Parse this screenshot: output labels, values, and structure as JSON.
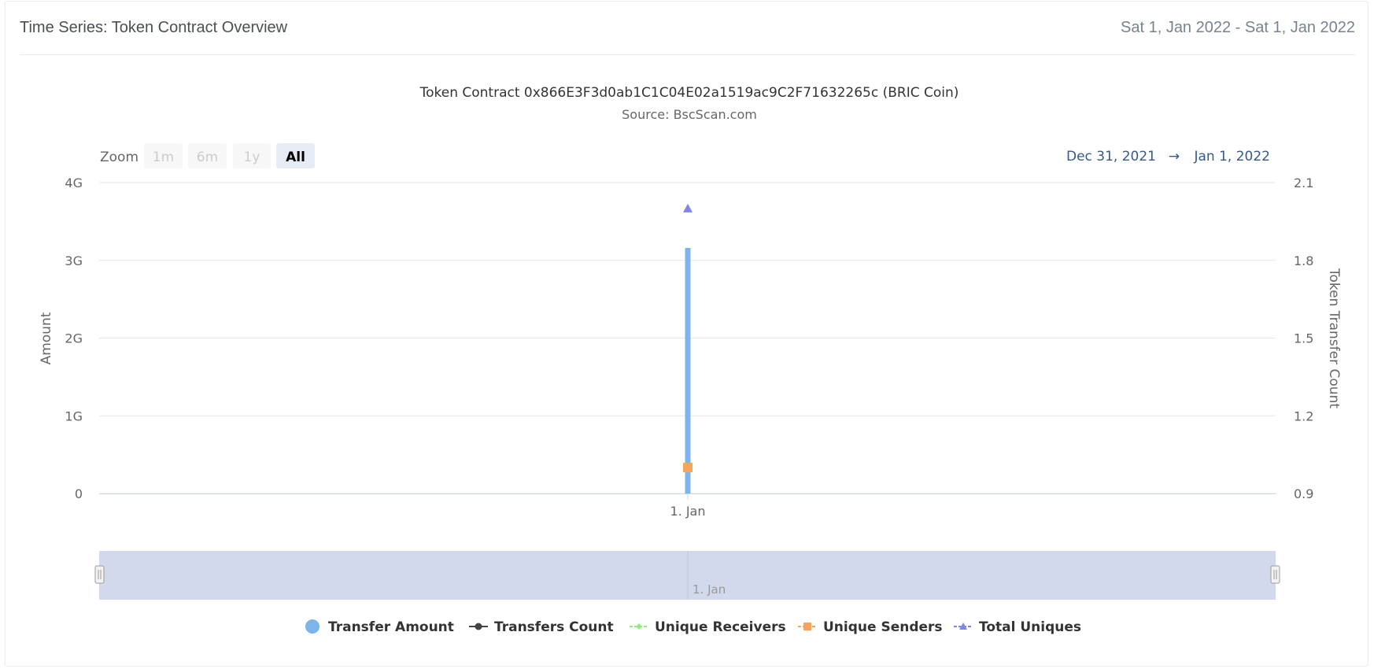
{
  "card": {
    "title": "Time Series: Token Contract Overview",
    "date_range": "Sat 1, Jan 2022 - Sat 1, Jan 2022"
  },
  "range_selector": {
    "zoom_label": "Zoom",
    "buttons": [
      "1m",
      "6m",
      "1y",
      "All"
    ],
    "active": "All",
    "from": "Dec 31, 2021",
    "arrow": "→",
    "to": "Jan 1, 2022"
  },
  "navigator": {
    "label": "1. Jan"
  },
  "colors": {
    "transfer_amount": "#7cb5ec",
    "transfers_count": "#434348",
    "unique_receivers": "#90ed7d",
    "unique_senders": "#f7a35c",
    "total_uniques": "#8085e9",
    "navigator_fill": "#d3d9ec",
    "grid": "#e6e6e6"
  },
  "chart_data": {
    "type": "bar",
    "title": "Token Contract 0x866E3F3d0ab1C1C04E02a1519ac9C2F71632265c (BRIC Coin)",
    "subtitle": "Source: BscScan.com",
    "categories": [
      "1. Jan"
    ],
    "ylabel": "Amount",
    "ylabel_right": "Token Transfer Count",
    "ylim": [
      0,
      4000000000
    ],
    "ylim_right": [
      0.9,
      2.1
    ],
    "yticks": [
      0,
      1000000000,
      2000000000,
      3000000000,
      4000000000
    ],
    "ytick_labels": [
      "0",
      "1G",
      "2G",
      "3G",
      "4G"
    ],
    "yticks_right": [
      0.9,
      1.2,
      1.5,
      1.8,
      2.1
    ],
    "ytick_labels_right": [
      "0.9",
      "1.2",
      "1.5",
      "1.8",
      "2.1"
    ],
    "grid": true,
    "legend_position": "bottom-center",
    "series": [
      {
        "name": "Transfer Amount",
        "type": "column",
        "axis": "left",
        "values": [
          3160000000
        ],
        "marker": "circle",
        "color_key": "transfer_amount"
      },
      {
        "name": "Transfers Count",
        "type": "line",
        "axis": "right",
        "values": [
          1
        ],
        "marker": "circle",
        "color_key": "transfers_count"
      },
      {
        "name": "Unique Receivers",
        "type": "line",
        "axis": "right",
        "values": [
          1
        ],
        "marker": "diamond",
        "color_key": "unique_receivers"
      },
      {
        "name": "Unique Senders",
        "type": "line",
        "axis": "right",
        "values": [
          1
        ],
        "marker": "square",
        "color_key": "unique_senders"
      },
      {
        "name": "Total Uniques",
        "type": "line",
        "axis": "right",
        "values": [
          2
        ],
        "marker": "triangle",
        "color_key": "total_uniques"
      }
    ]
  }
}
